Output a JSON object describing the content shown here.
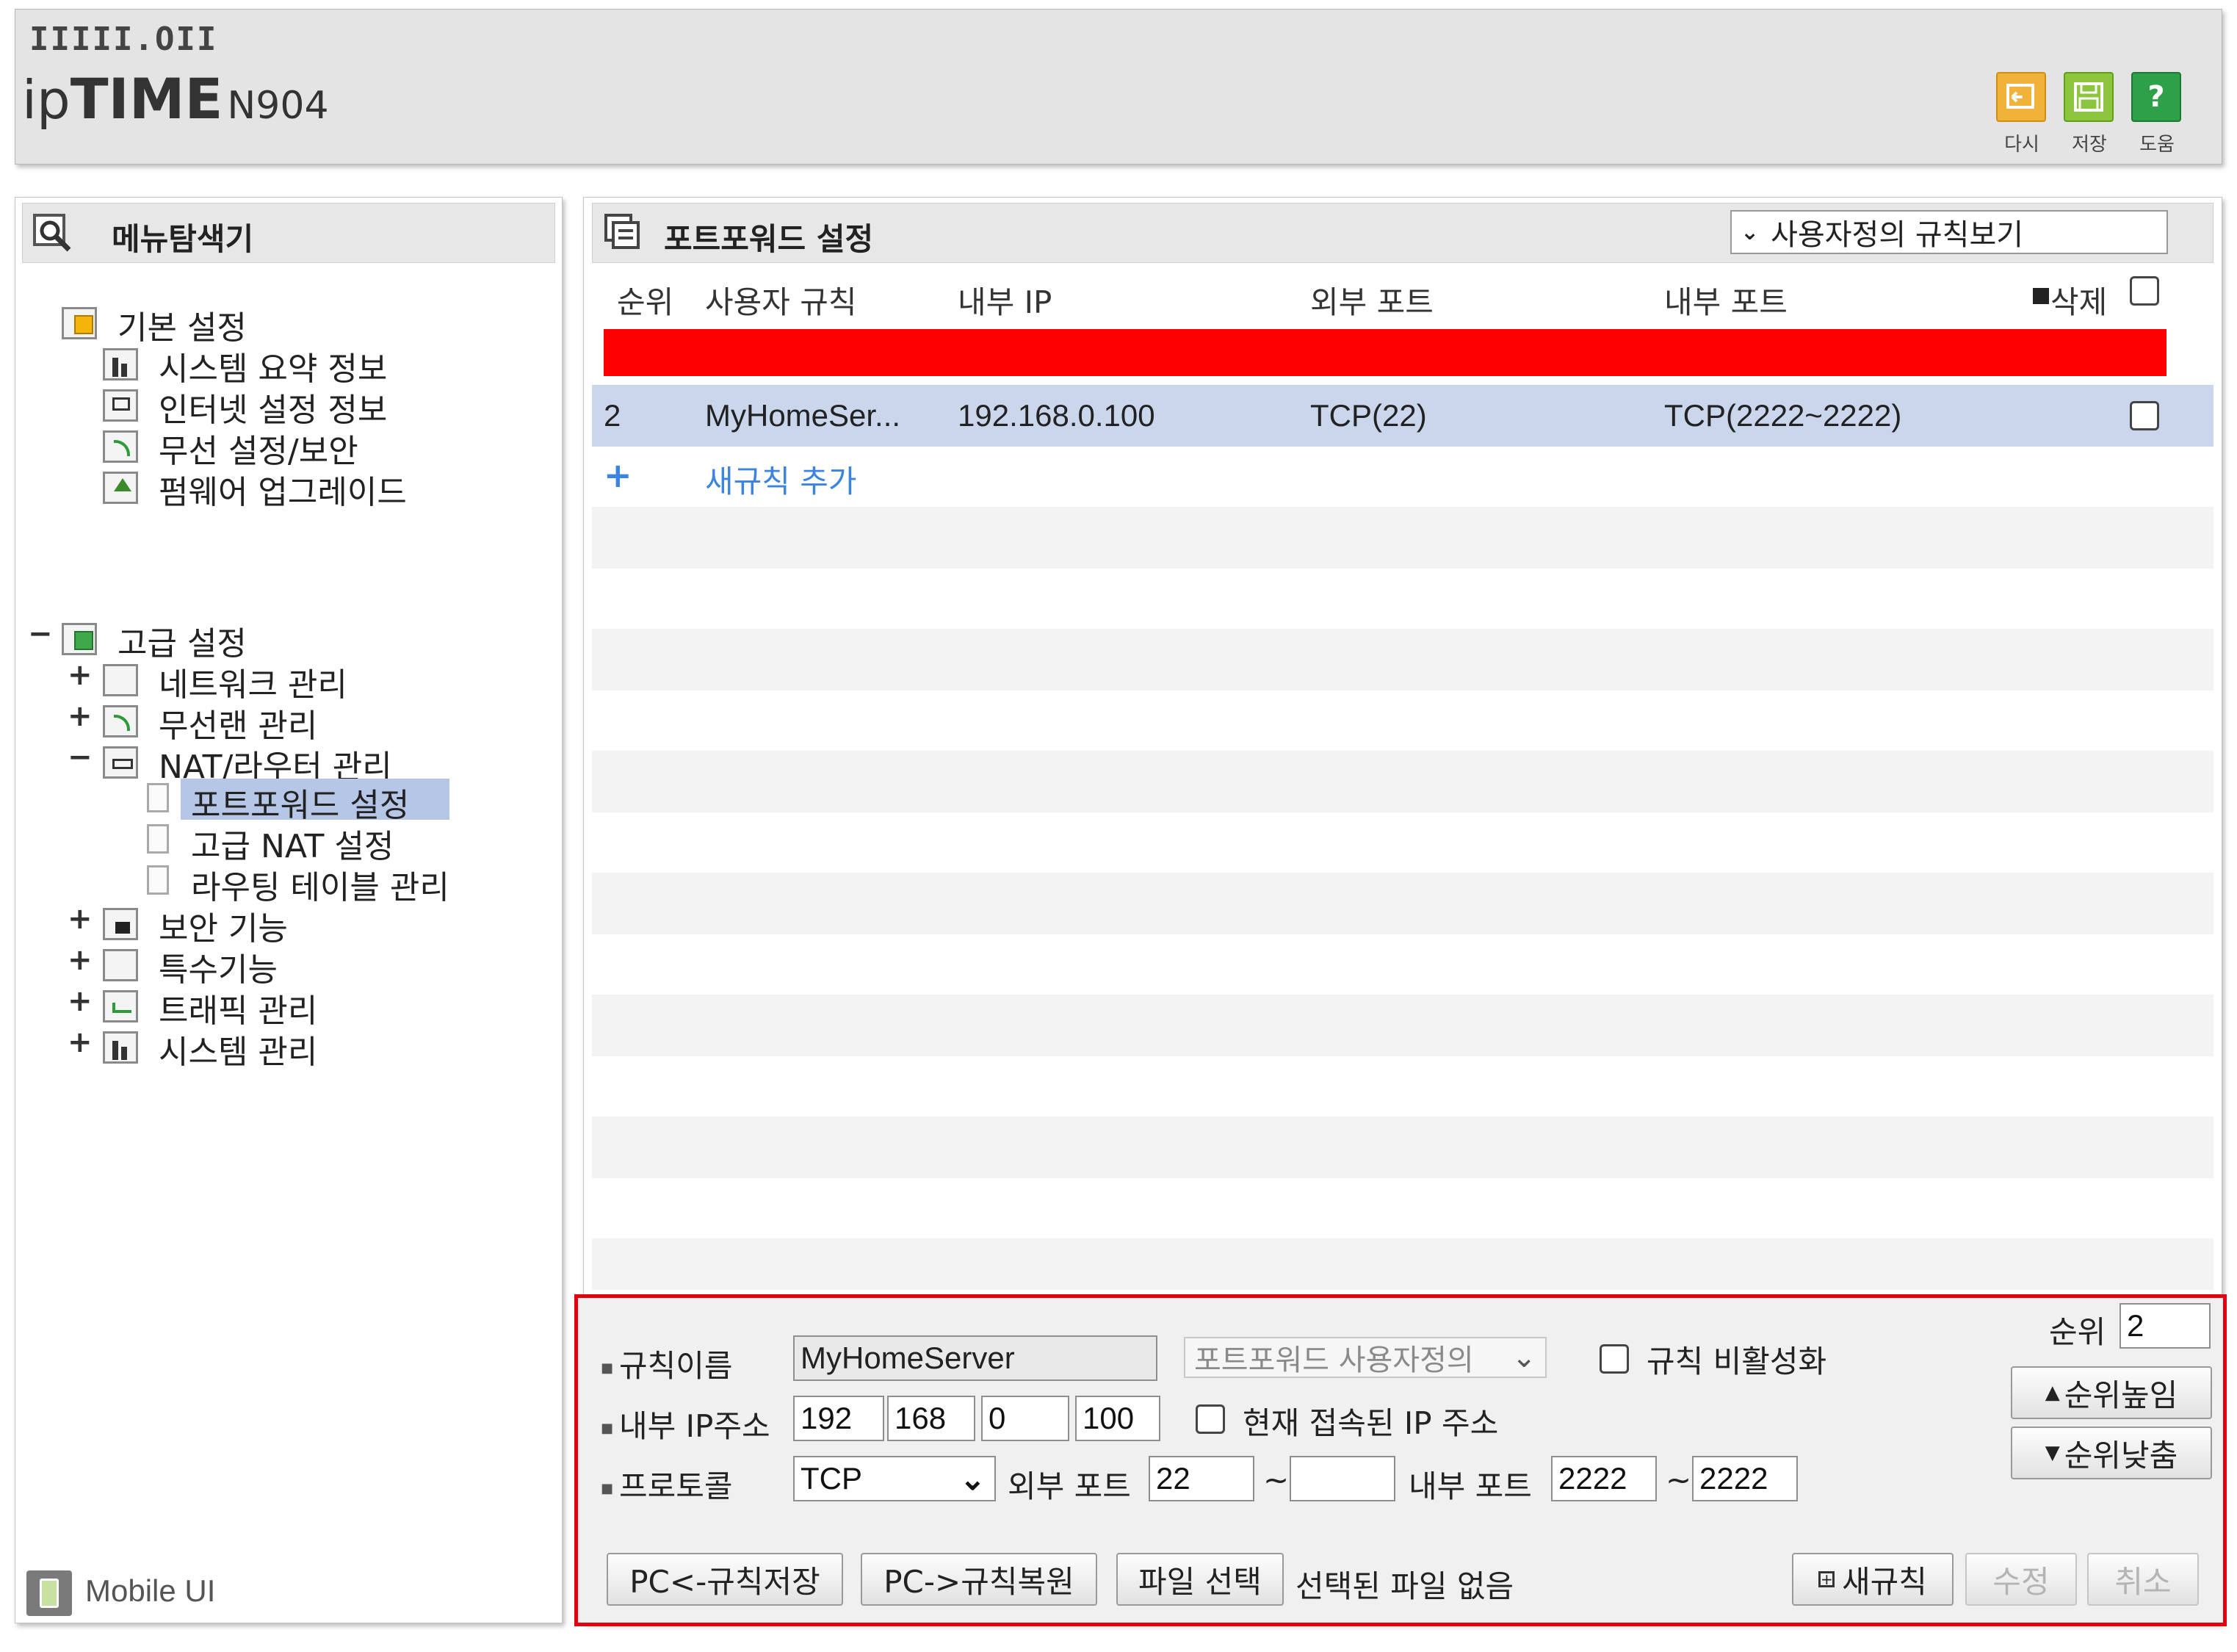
{
  "header": {
    "logo_top": "IIIII.OII",
    "logo_ip": "ip",
    "logo_time": "TIME",
    "model": "N904",
    "buttons": [
      {
        "label": "다시",
        "icon": "undo-icon",
        "color": "#f0b238"
      },
      {
        "label": "저장",
        "icon": "save-icon",
        "color": "#8cc63e"
      },
      {
        "label": "도움",
        "icon": "help-icon",
        "color": "#2fa04a"
      }
    ]
  },
  "sidebar": {
    "title": "메뉴탐색기",
    "basic": {
      "label": "기본 설정",
      "items": [
        "시스템 요약 정보",
        "인터넷 설정 정보",
        "무선 설정/보안",
        "펌웨어 업그레이드"
      ]
    },
    "advanced": {
      "toggle": "−",
      "label": "고급 설정",
      "items": [
        {
          "sign": "+",
          "label": "네트워크 관리"
        },
        {
          "sign": "+",
          "label": "무선랜 관리"
        },
        {
          "sign": "−",
          "label": "NAT/라우터 관리"
        }
      ],
      "nat_children": [
        "포트포워드 설정",
        "고급 NAT 설정",
        "라우팅 테이블 관리"
      ],
      "more": [
        {
          "sign": "+",
          "label": "보안 기능"
        },
        {
          "sign": "+",
          "label": "특수기능"
        },
        {
          "sign": "+",
          "label": "트래픽 관리"
        },
        {
          "sign": "+",
          "label": "시스템 관리"
        }
      ]
    },
    "mobile_ui": "Mobile UI"
  },
  "main": {
    "title": "포트포워드 설정",
    "view_select": "사용자정의 규칙보기",
    "columns": {
      "order": "순위",
      "rule": "사용자 규칙",
      "internal_ip": "내부 IP",
      "external_port": "외부 포트",
      "internal_port": "내부 포트",
      "delete": "삭제"
    },
    "rows": [
      {
        "order": "2",
        "rule": "MyHomeSer...",
        "ip": "192.168.0.100",
        "ext": "TCP(22)",
        "int": "TCP(2222~2222)"
      }
    ],
    "add_rule_sign": "+",
    "add_rule": "새규칙 추가"
  },
  "form": {
    "rule_name_label": "규칙이름",
    "rule_name": "MyHomeServer",
    "preset": "포트포워드 사용자정의",
    "disable_rule": "규칙 비활성화",
    "order_label": "순위",
    "order": "2",
    "ip_label": "내부 IP주소",
    "ip": [
      "192",
      "168",
      "0",
      "100"
    ],
    "current_ip": "현재 접속된 IP 주소",
    "protocol_label": "프로토콜",
    "protocol": "TCP",
    "ext_port_label": "외부 포트",
    "ext_port_from": "22",
    "ext_port_to": "",
    "int_port_label": "내부 포트",
    "int_port_from": "2222",
    "int_port_to": "2222",
    "tilde": "~",
    "up": "순위높임",
    "down": "순위낮춤",
    "save_pc": "PC<-규칙저장",
    "restore_pc": "PC->규칙복원",
    "choose_file": "파일 선택",
    "no_file": "선택된 파일 없음",
    "new_rule": "새규칙",
    "modify": "수정",
    "cancel": "취소"
  }
}
